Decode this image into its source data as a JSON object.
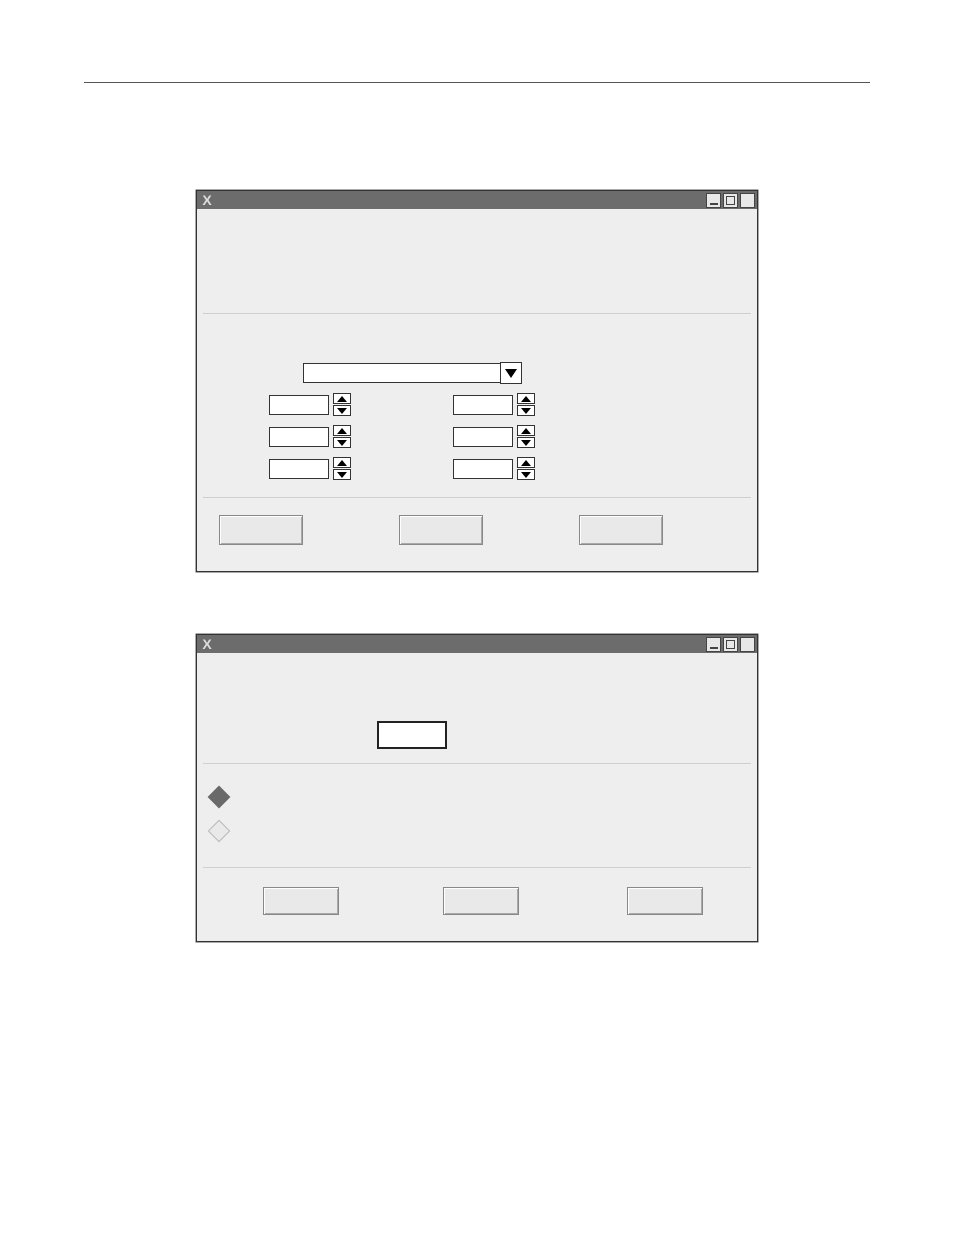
{
  "window_top": {
    "titlebar_icon": "X",
    "ctrl_minimize": "",
    "ctrl_restore": "",
    "ctrl_maximize": "",
    "combo_value": "",
    "spin_left_1": "",
    "spin_left_2": "",
    "spin_left_3": "",
    "spin_right_1": "",
    "spin_right_2": "",
    "spin_right_3": "",
    "btn1_label": "",
    "btn2_label": "",
    "btn3_label": ""
  },
  "window_bottom": {
    "titlebar_icon": "X",
    "ctrl_minimize": "",
    "ctrl_restore": "",
    "ctrl_maximize": "",
    "value_box": "",
    "radio1_label": "",
    "radio2_label": "",
    "btn1_label": "",
    "btn2_label": "",
    "btn3_label": ""
  }
}
